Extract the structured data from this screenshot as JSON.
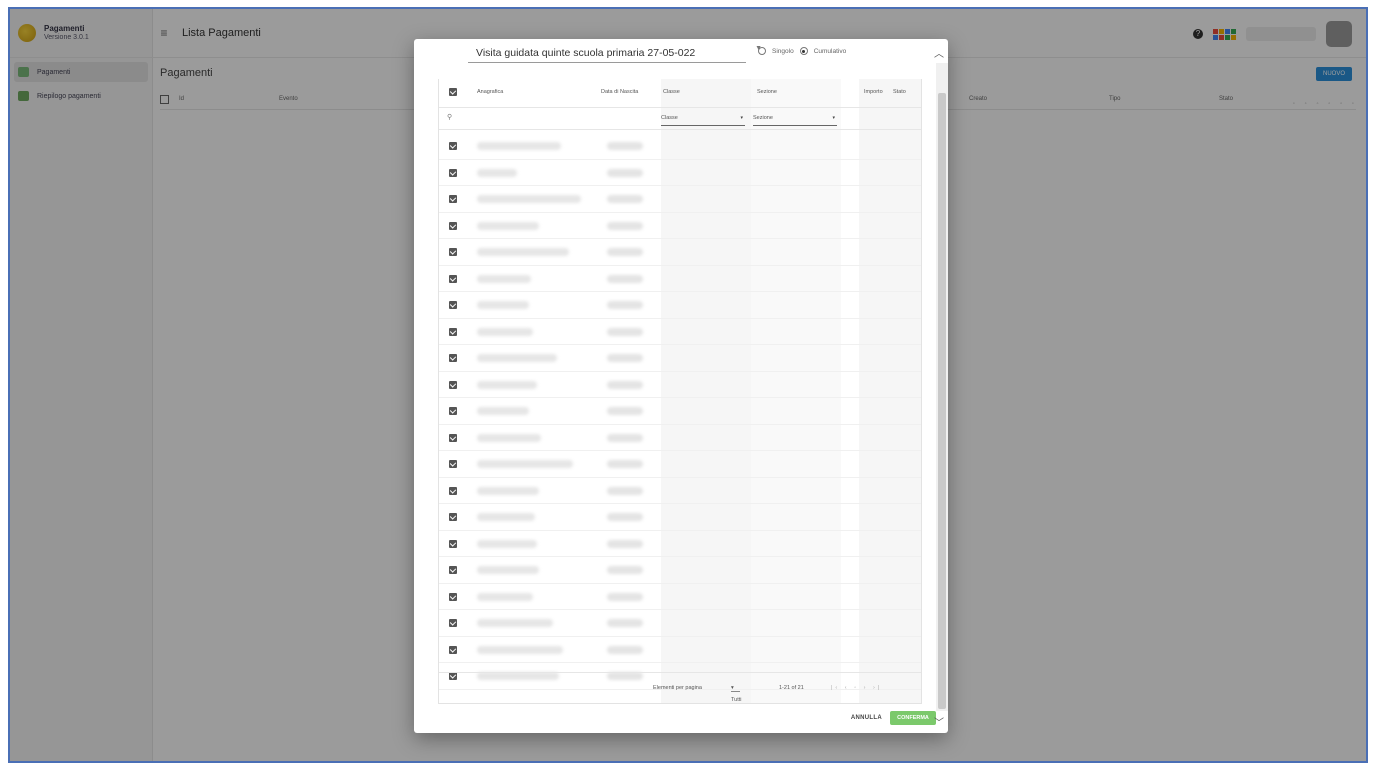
{
  "app": {
    "brand_name": "Pagamenti",
    "brand_version": "Versione 3.0.1",
    "title": "Lista Pagamenti",
    "sidebar": {
      "items": [
        {
          "label": "Pagamenti",
          "icon": "payments-icon",
          "active": true
        },
        {
          "label": "Riepilogo pagamenti",
          "icon": "summary-icon",
          "active": false
        }
      ]
    },
    "section_title": "Pagamenti",
    "new_button": "NUOVO",
    "bg_columns": [
      "Id",
      "Evento",
      "Creato",
      "Tipo",
      "Stato"
    ]
  },
  "modal": {
    "event_select": "Visita guidata quinte scuola primaria 27-05-022",
    "radio_options": [
      {
        "label": "Singolo",
        "selected": false
      },
      {
        "label": "Cumulativo",
        "selected": true
      }
    ],
    "columns": [
      "Anagrafica",
      "Data di Nascita",
      "Classe",
      "Sezione",
      "Importo",
      "Stato"
    ],
    "filter_row": {
      "classe_placeholder": "Classe",
      "sezione_placeholder": "Sezione"
    },
    "row_count": 21,
    "pager": {
      "rows_per_page_label": "Elementi per pagina",
      "rows_per_page_value": "Tutti",
      "range": "1-21 of 21"
    },
    "cancel_label": "ANNULLA",
    "confirm_label": "CONFERMA"
  },
  "colors": {
    "accent": "#2b8fd8",
    "confirm": "#7bc96b",
    "overlay": "rgba(0,0,0,0.38)"
  }
}
